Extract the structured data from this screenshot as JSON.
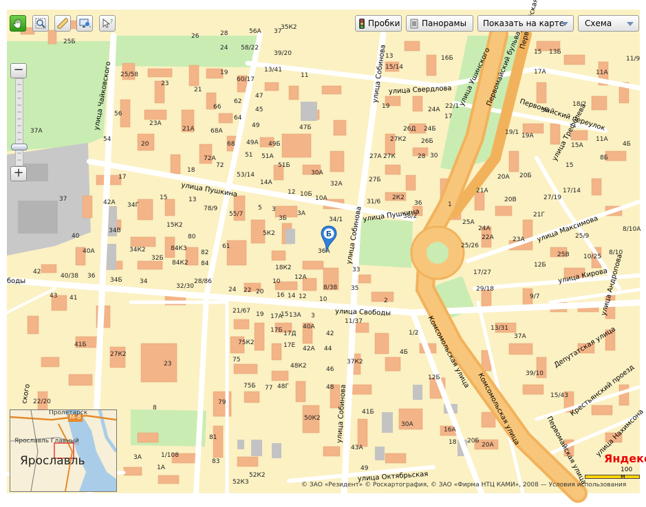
{
  "toolbar": {
    "traffic_label": "Пробки",
    "panoramas_label": "Панорамы",
    "show_on_map_label": "Показать на карте",
    "map_type_label": "Схема"
  },
  "zoom": {
    "plus": "+",
    "minus": "−",
    "level": 0.18
  },
  "streets": {
    "sverdlova": "улица Свердлова",
    "pushkina_w": "улица Пушкина",
    "pushkina_e": "улица Пушкина",
    "svobody": "улица Свободы",
    "sobinova_n": "улица Собинова",
    "sobinova_m": "улица Собинова",
    "sobinova_s": "улица Собинова",
    "chaikovskogo": "улица Чайковского",
    "ushinskogo": "улица Ушинского",
    "pervomaisky_bulvar": "Первомайский бульвар",
    "pervomaisky_pereulok": "Первомайский переулок",
    "trefoleva": "улица Трефолева",
    "maksimova": "улица Максимова",
    "kirova": "улица Кирова",
    "andropova": "улица Андропова",
    "komsomolskaya_1": "Комсомольская улица",
    "komsomolskaya_2": "Комсомольская улица",
    "deputatskaya": "Депутатская улица",
    "krestyansky": "Крестьянский проезд",
    "pervomaiskaya": "Первомайская улица",
    "nakhimsona": "улица Нахимсона",
    "oktyabrskaya": "улица Октябрьская",
    "pervomaiskaya_top": "Первомайская",
    "left_cut_1": "ского",
    "left_cut_2": "боды"
  },
  "house_numbers": {
    "h1": "25Б",
    "h2": "26",
    "h3": "28",
    "h4": "24",
    "h5": "58/22",
    "h6": "56А",
    "h7": "37",
    "h8": "35К2",
    "h9": "39/20",
    "h10": "25/58",
    "h11": "23",
    "h12": "19",
    "h13": "60/17",
    "h14": "13/41",
    "h15": "11",
    "h16": "21",
    "h17": "66",
    "h18": "56",
    "h19": "47",
    "h20": "45",
    "h21": "62",
    "h22": "64",
    "h23": "23А",
    "h24": "21А",
    "h25": "68А",
    "h26": "49",
    "h27": "47Б",
    "h28": "54",
    "h29": "20",
    "h30": "68",
    "h31": "49А",
    "h32": "49Б",
    "h33": "72А",
    "h34": "72",
    "h35": "51",
    "h36": "51А",
    "h37": "51Б",
    "h38": "18",
    "h39": "53/14",
    "h40": "14А",
    "h41": "12",
    "h42": "10Б",
    "h43": "10А",
    "h44": "30А",
    "h45": "32А",
    "h46": "17",
    "h47": "37А",
    "h48": "37",
    "h49": "42А",
    "h50": "34Г",
    "h51": "15",
    "h52": "13",
    "h53": "78/9",
    "h54": "55/7",
    "h55": "5",
    "h56": "3",
    "h57": "3Б",
    "h58": "3А",
    "h59": "34/1",
    "h60": "15К2",
    "h61": "34В",
    "h62": "40",
    "h63": "80",
    "h64": "5К2",
    "h65": "34К2",
    "h66": "84К3",
    "h67": "40А",
    "h68": "32Б",
    "h69": "84К2",
    "h70": "82",
    "h71": "61",
    "h72": "18К2",
    "h73": "84",
    "h74": "36А",
    "h75": "42",
    "h76": "40/38",
    "h77": "36",
    "h78": "34Б",
    "h79": "34",
    "h80": "32/30",
    "h81": "28/86",
    "h82": "12А",
    "h83": "10",
    "h84": "24",
    "h85": "22",
    "h86": "20",
    "h87": "16",
    "h88": "14",
    "h89": "12",
    "h90": "10",
    "h91": "8/38",
    "h92": "33",
    "h93": "35",
    "h94": "2",
    "h95": "43",
    "h96": "41",
    "h97": "21/67",
    "h98": "19",
    "h99": "17А",
    "h100": "15",
    "h101": "13А",
    "h102": "3",
    "h103": "40А",
    "h104": "11/37",
    "h105": "41Б",
    "h106": "17Б",
    "h107": "17Д",
    "h108": "42",
    "h109": "75К2",
    "h110": "17Е",
    "h111": "42А",
    "h112": "44",
    "h113": "27К2",
    "h114": "23",
    "h115": "75",
    "h116": "48К2",
    "h117": "37К2",
    "h118": "46",
    "h119": "75Б",
    "h120": "77",
    "h121": "48Г",
    "h122": "48",
    "h123": "79",
    "h124": "50К2",
    "h125": "8",
    "h126": "22/20",
    "h127": "81",
    "h128": "83",
    "h129": "3А",
    "h130": "1/108",
    "h131": "1А",
    "h132": "52К2",
    "h133": "52К3",
    "h134": "41Б",
    "h135": "43А",
    "h136": "49",
    "h137": "30А",
    "h138": "16А",
    "h139": "20Б",
    "h140": "18",
    "h141": "20А",
    "h142": "15/14",
    "h143": "13",
    "h144": "19",
    "h145": "24А",
    "h146": "22/1",
    "h147": "17",
    "h148": "16Б",
    "h149": "26Д",
    "h150": "24Б",
    "h151": "27К2",
    "h152": "26Б",
    "h153": "27А",
    "h154": "27К",
    "h155": "28",
    "h156": "30",
    "h157": "27Б",
    "h158": "31/6",
    "h159": "2К2",
    "h160": "36",
    "h161": "38/2",
    "h162": "1",
    "h163": "21А",
    "h164": "25А",
    "h165": "24А",
    "h166": "22А",
    "h167": "25/26",
    "h168": "17/27",
    "h169": "29/18",
    "h170": "13/31",
    "h171": "37А",
    "h172": "39/10",
    "h173": "15/43",
    "h174": "12Б",
    "h175": "4Б",
    "h176": "1/2",
    "h177": "9/7",
    "h178": "19/1",
    "h179": "19А",
    "h180": "20А",
    "h181": "20Б",
    "h182": "20В",
    "h183": "27/19",
    "h184": "21Г",
    "h185": "23А",
    "h186": "25В",
    "h187": "17/14",
    "h188": "15А",
    "h189": "11А",
    "h190": "8Б",
    "h191": "15",
    "h192": "12Б",
    "h193": "10/25",
    "h194": "8/10",
    "h195": "25/9",
    "h196": "8/10А",
    "h197": "3Б",
    "h198": "17А",
    "h199": "13Б",
    "h200": "15",
    "h201": "11/9",
    "h202": "18/2",
    "h203": "4Б",
    "h204": "11А"
  },
  "marker": {
    "letter": "Б"
  },
  "minimap": {
    "city": "Ярославль",
    "station": "Ярославль Главный",
    "road": "М-8",
    "district": "Пролетарск"
  },
  "footer": {
    "copyright": "© ЗАО «Резидент» © Роскартография, © ЗАО «Фирма НТЦ КАМИ», 2008 — Условия использования",
    "logo": "Яндекс",
    "scale": "100 м"
  }
}
